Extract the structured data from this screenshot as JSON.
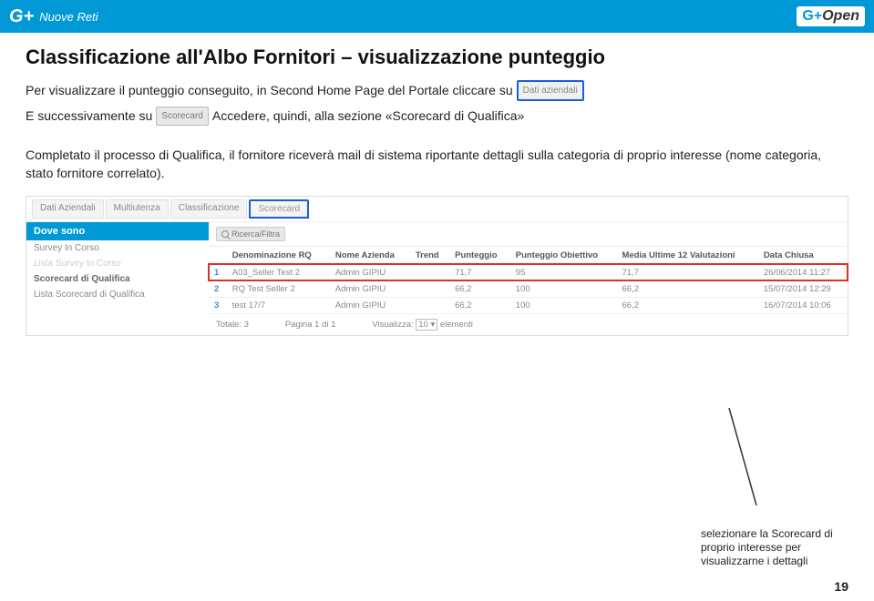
{
  "header": {
    "brand_left": "G+",
    "brand_sub": "Nuove Reti",
    "brand_right_g": "G+",
    "brand_right_open": "Open"
  },
  "title": "Classificazione all'Albo Fornitori – visualizzazione punteggio",
  "intro": {
    "line1a": "Per visualizzare il punteggio conseguito, in Second Home Page del Portale cliccare su",
    "btn_dati": "Dati aziendali",
    "line2a": "E successivamente su",
    "btn_scorecard": "Scorecard",
    "line2b": "Accedere, quindi, alla sezione «Scorecard di Qualifica»"
  },
  "para2": "Completato il processo di Qualifica, il fornitore riceverà mail di sistema riportante dettagli sulla categoria di proprio interesse (nome categoria, stato fornitore correlato).",
  "app": {
    "tabs": [
      "Dati Aziendali",
      "Multiutenza",
      "Classificazione",
      "Scorecard"
    ],
    "active_tab_index": 3,
    "left_header": "Dove sono",
    "left_items": [
      {
        "label": "Survey In Corso",
        "faded": false
      },
      {
        "label": "Lista Survey In Corso",
        "faded": true
      },
      {
        "label": "Scorecard di Qualifica",
        "bold": true
      },
      {
        "label": "Lista Scorecard di Qualifica",
        "faded": false
      }
    ],
    "toolbar_btn": "Ricerca/Filtra",
    "columns": [
      "",
      "Denominazione RQ",
      "Nome Azienda",
      "Trend",
      "Punteggio",
      "Punteggio Obiettivo",
      "Media Ultime 12 Valutazioni",
      "Data Chiusa"
    ],
    "rows": [
      {
        "n": "1",
        "den": "A03_Seller Test 2",
        "az": "Admin GIPIU",
        "tr": "",
        "p": "71,7",
        "po": "95",
        "m": "71,7",
        "dc": "26/06/2014 11:27"
      },
      {
        "n": "2",
        "den": "RQ Test Seller 2",
        "az": "Admin GIPIU",
        "tr": "",
        "p": "66,2",
        "po": "100",
        "m": "66,2",
        "dc": "15/07/2014 12:29"
      },
      {
        "n": "3",
        "den": "test 17/7",
        "az": "Admin GIPIU",
        "tr": "",
        "p": "66,2",
        "po": "100",
        "m": "66,2",
        "dc": "16/07/2014 10:06"
      }
    ],
    "footer": {
      "totale": "Totale: 3",
      "pagina": "Pagina 1 di 1",
      "vis_a": "Visualizza:",
      "vis_sel": "10",
      "vis_b": "elementi"
    }
  },
  "callout": "selezionare la Scorecard di proprio interesse per visualizzarne i dettagli",
  "page_number": "19"
}
